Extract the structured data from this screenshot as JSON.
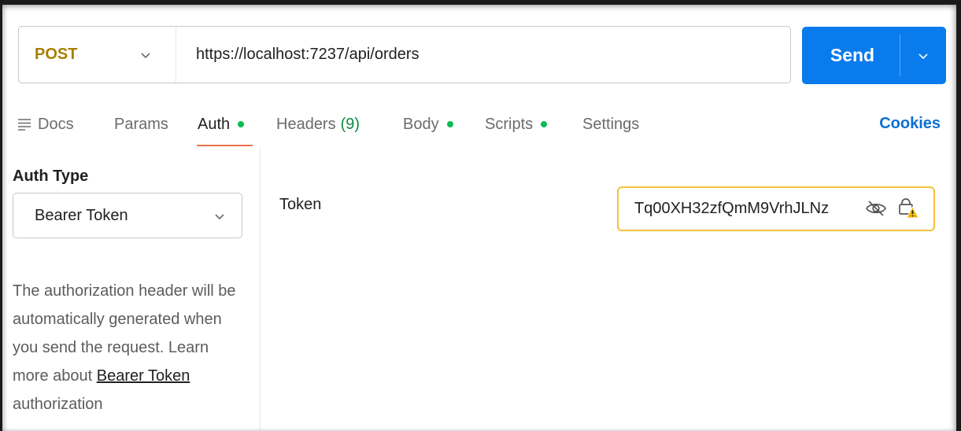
{
  "request": {
    "method": "POST",
    "url": "https://localhost:7237/api/orders",
    "send_label": "Send"
  },
  "tabs": {
    "docs": "Docs",
    "params": "Params",
    "auth": "Auth",
    "headers": "Headers",
    "headers_count": "(9)",
    "body": "Body",
    "scripts": "Scripts",
    "settings": "Settings",
    "cookies": "Cookies"
  },
  "auth": {
    "type_label": "Auth Type",
    "type_value": "Bearer Token",
    "desc_pre": "The authorization header will be automatically generated when you send the request. Learn more about ",
    "desc_link": "Bearer Token",
    "desc_post": " authorization",
    "token_label": "Token",
    "token_value": "Tq00XH32zfQmM9VrhJLNz"
  },
  "colors": {
    "method": "#a97e00",
    "send": "#097bed",
    "active_dot": "#0cbb52",
    "tab_underline": "#e8734a",
    "token_border": "#f3c13a",
    "cookies": "#0d6fd6"
  },
  "icons": [
    "chevron-down-icon",
    "docs-icon",
    "eye-off-icon",
    "lock-warning-icon"
  ]
}
